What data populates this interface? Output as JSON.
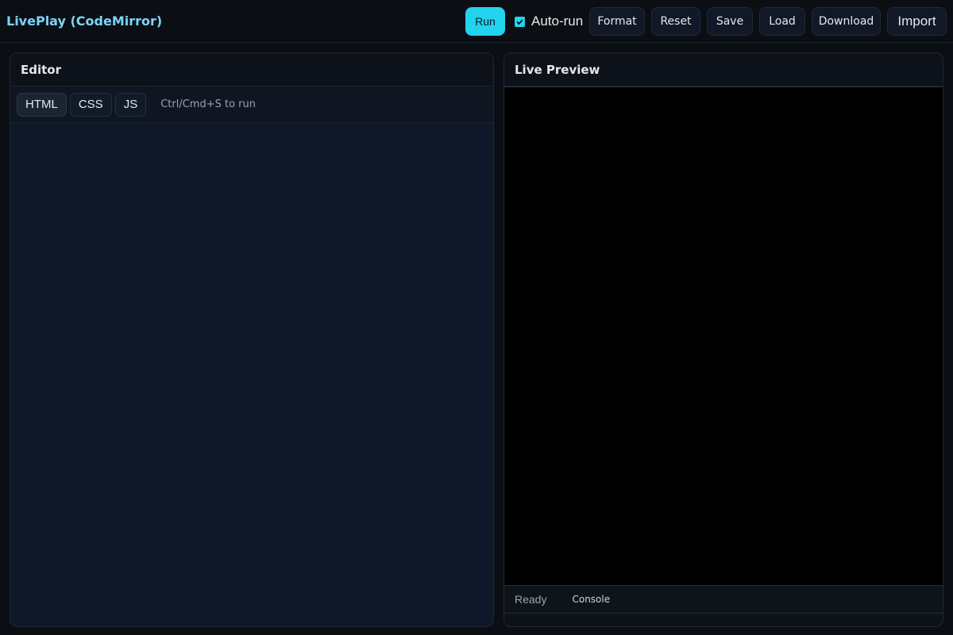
{
  "app": {
    "title": "LivePlay (CodeMirror)"
  },
  "toolbar": {
    "run_label": "Run",
    "autorun_label": "Auto-run",
    "autorun_checked": true,
    "format_label": "Format",
    "reset_label": "Reset",
    "save_label": "Save",
    "load_label": "Load",
    "download_label": "Download",
    "import_label": "Import"
  },
  "editor": {
    "title": "Editor",
    "tabs": [
      {
        "label": "HTML",
        "active": true
      },
      {
        "label": "CSS",
        "active": false
      },
      {
        "label": "JS",
        "active": false
      }
    ],
    "hint": "Ctrl/Cmd+S to run"
  },
  "preview": {
    "title": "Live Preview",
    "status": "Ready",
    "console_label": "Console"
  },
  "colors": {
    "accent": "#22d3ee",
    "title": "#7dd3fc",
    "background": "#0b0f14"
  },
  "icons": {
    "checkbox": "check-icon"
  }
}
